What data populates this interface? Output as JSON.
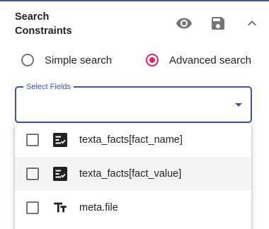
{
  "panel": {
    "title": "Search Constraints",
    "accent_color": "#3f51b5",
    "radio_accent_color": "#e91e63",
    "actions": [
      {
        "icon": "eye-icon"
      },
      {
        "icon": "save-icon"
      },
      {
        "icon": "chevron-up-icon"
      }
    ]
  },
  "search_mode": {
    "options": [
      {
        "label": "Simple search",
        "checked": false
      },
      {
        "label": "Advanced search",
        "checked": true
      }
    ]
  },
  "select_fields": {
    "label": "Select Fields",
    "value": "",
    "options": [
      {
        "label": "texta_facts[fact_name]",
        "icon": "fact-list-icon",
        "checked": false
      },
      {
        "label": "texta_facts[fact_value]",
        "icon": "fact-list-icon",
        "checked": false
      },
      {
        "label": "meta.file",
        "icon": "text-fields-icon",
        "checked": false
      }
    ]
  }
}
